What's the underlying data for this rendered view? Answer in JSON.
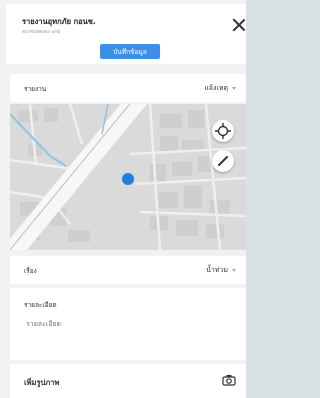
{
  "header": {
    "title": "รายงานอุทกภัย กอนช.",
    "subtitle": "สมาคมทดลอง web",
    "save_label": "บันทึกข้อมูล"
  },
  "report_row": {
    "label": "รายงาน",
    "value": "แจ้งเหตุ"
  },
  "map": {
    "controls": [
      "crosshair-icon",
      "pencil-icon"
    ],
    "marker_color": "#1f7fe0"
  },
  "topic_row": {
    "label": "เรื่อง",
    "value": "น้ำท่วม"
  },
  "detail_row": {
    "label": "รายละเอียด",
    "placeholder": "รายละเอียด"
  },
  "photo_row": {
    "label": "เพิ่มรูปภาพ"
  },
  "colors": {
    "accent": "#3d8fe6",
    "background": "#f2f2f2"
  }
}
